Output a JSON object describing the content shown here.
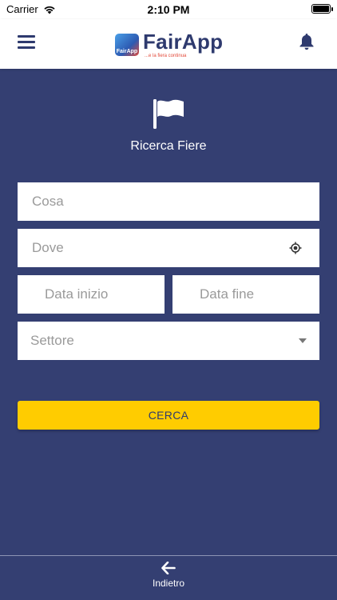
{
  "status_bar": {
    "carrier": "Carrier",
    "time": "2:10 PM"
  },
  "header": {
    "app_name": "FairApp",
    "tagline": "...e la fiera continua",
    "badge_text": "FairApp"
  },
  "hero": {
    "title": "Ricerca Fiere"
  },
  "form": {
    "what_placeholder": "Cosa",
    "where_placeholder": "Dove",
    "start_date_placeholder": "Data inizio",
    "end_date_placeholder": "Data fine",
    "sector_placeholder": "Settore",
    "search_label": "CERCA"
  },
  "footer": {
    "back_label": "Indietro"
  },
  "colors": {
    "background": "#343F72",
    "accent": "#FFCC00",
    "brand": "#2E3A6E"
  }
}
